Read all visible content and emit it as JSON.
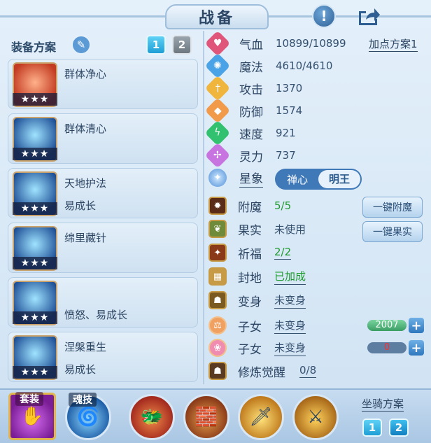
{
  "header": {
    "title": "战备",
    "info_icon": "!"
  },
  "equipment": {
    "label": "装备方案",
    "tabs": [
      "1",
      "2"
    ],
    "items": [
      {
        "name": "群体净心",
        "sub": "",
        "stars": "★★★",
        "color": "#e05b3b"
      },
      {
        "name": "群体清心",
        "sub": "",
        "stars": "★★★",
        "color": "#2d7fd1"
      },
      {
        "name": "天地护法",
        "sub": "易成长",
        "stars": "★★★",
        "color": "#3b8fd8"
      },
      {
        "name": "绵里藏针",
        "sub": "",
        "stars": "★★★",
        "color": "#2e6fc7"
      },
      {
        "name": "",
        "sub": "愤怒、易成长",
        "stars": "★★★",
        "color": "#2b84d6"
      },
      {
        "name": "涅槃重生",
        "sub": "易成长",
        "stars": "★★★",
        "color": "#2a78c9"
      }
    ]
  },
  "stats": [
    {
      "name": "气血",
      "value": "10899/10899",
      "icon": "heart-icon",
      "color": "#e0567a",
      "glyph": "♥"
    },
    {
      "name": "魔法",
      "value": "4610/4610",
      "icon": "mana-icon",
      "color": "#4aa3e6",
      "glyph": "✺"
    },
    {
      "name": "攻击",
      "value": "1370",
      "icon": "attack-icon",
      "color": "#f0b53c",
      "glyph": "†"
    },
    {
      "name": "防御",
      "value": "1574",
      "icon": "defense-icon",
      "color": "#f09a4a",
      "glyph": "◆"
    },
    {
      "name": "速度",
      "value": "921",
      "icon": "speed-icon",
      "color": "#32c16e",
      "glyph": "ϟ"
    },
    {
      "name": "灵力",
      "value": "737",
      "icon": "spirit-icon",
      "color": "#c774e0",
      "glyph": "✢"
    }
  ],
  "plan_link": "加点方案1",
  "star_sign": {
    "label": "星象",
    "options": [
      "禅心",
      "明王"
    ],
    "selected": "明王"
  },
  "attributes": [
    {
      "name": "附魔",
      "value": "5/5",
      "value_style": "green"
    },
    {
      "name": "果实",
      "value": "未使用",
      "value_style": "plain"
    },
    {
      "name": "祈福",
      "value": "2/2",
      "value_style": "green-underline"
    },
    {
      "name": "封地",
      "value": "已加成",
      "value_style": "green-underline"
    },
    {
      "name": "变身",
      "value": "未变身",
      "value_style": "underline"
    },
    {
      "name": "子女",
      "value": "未变身",
      "value_style": "underline"
    },
    {
      "name": "子女",
      "value": "未变身",
      "value_style": "underline"
    },
    {
      "name": "修炼觉醒",
      "value": "0/8",
      "value_style": "underline"
    }
  ],
  "buttons": {
    "enchant": "一键附魔",
    "fruit": "一键果实",
    "plus": "+"
  },
  "child_bars": [
    {
      "value": "2007",
      "fill": 1.0
    },
    {
      "value": "0",
      "fill": 0.0
    }
  ],
  "bottom": {
    "suit_label": "套装",
    "soul_label": "魂技",
    "mount_label": "坐骑方案",
    "mount_tabs": [
      "1",
      "2"
    ]
  }
}
